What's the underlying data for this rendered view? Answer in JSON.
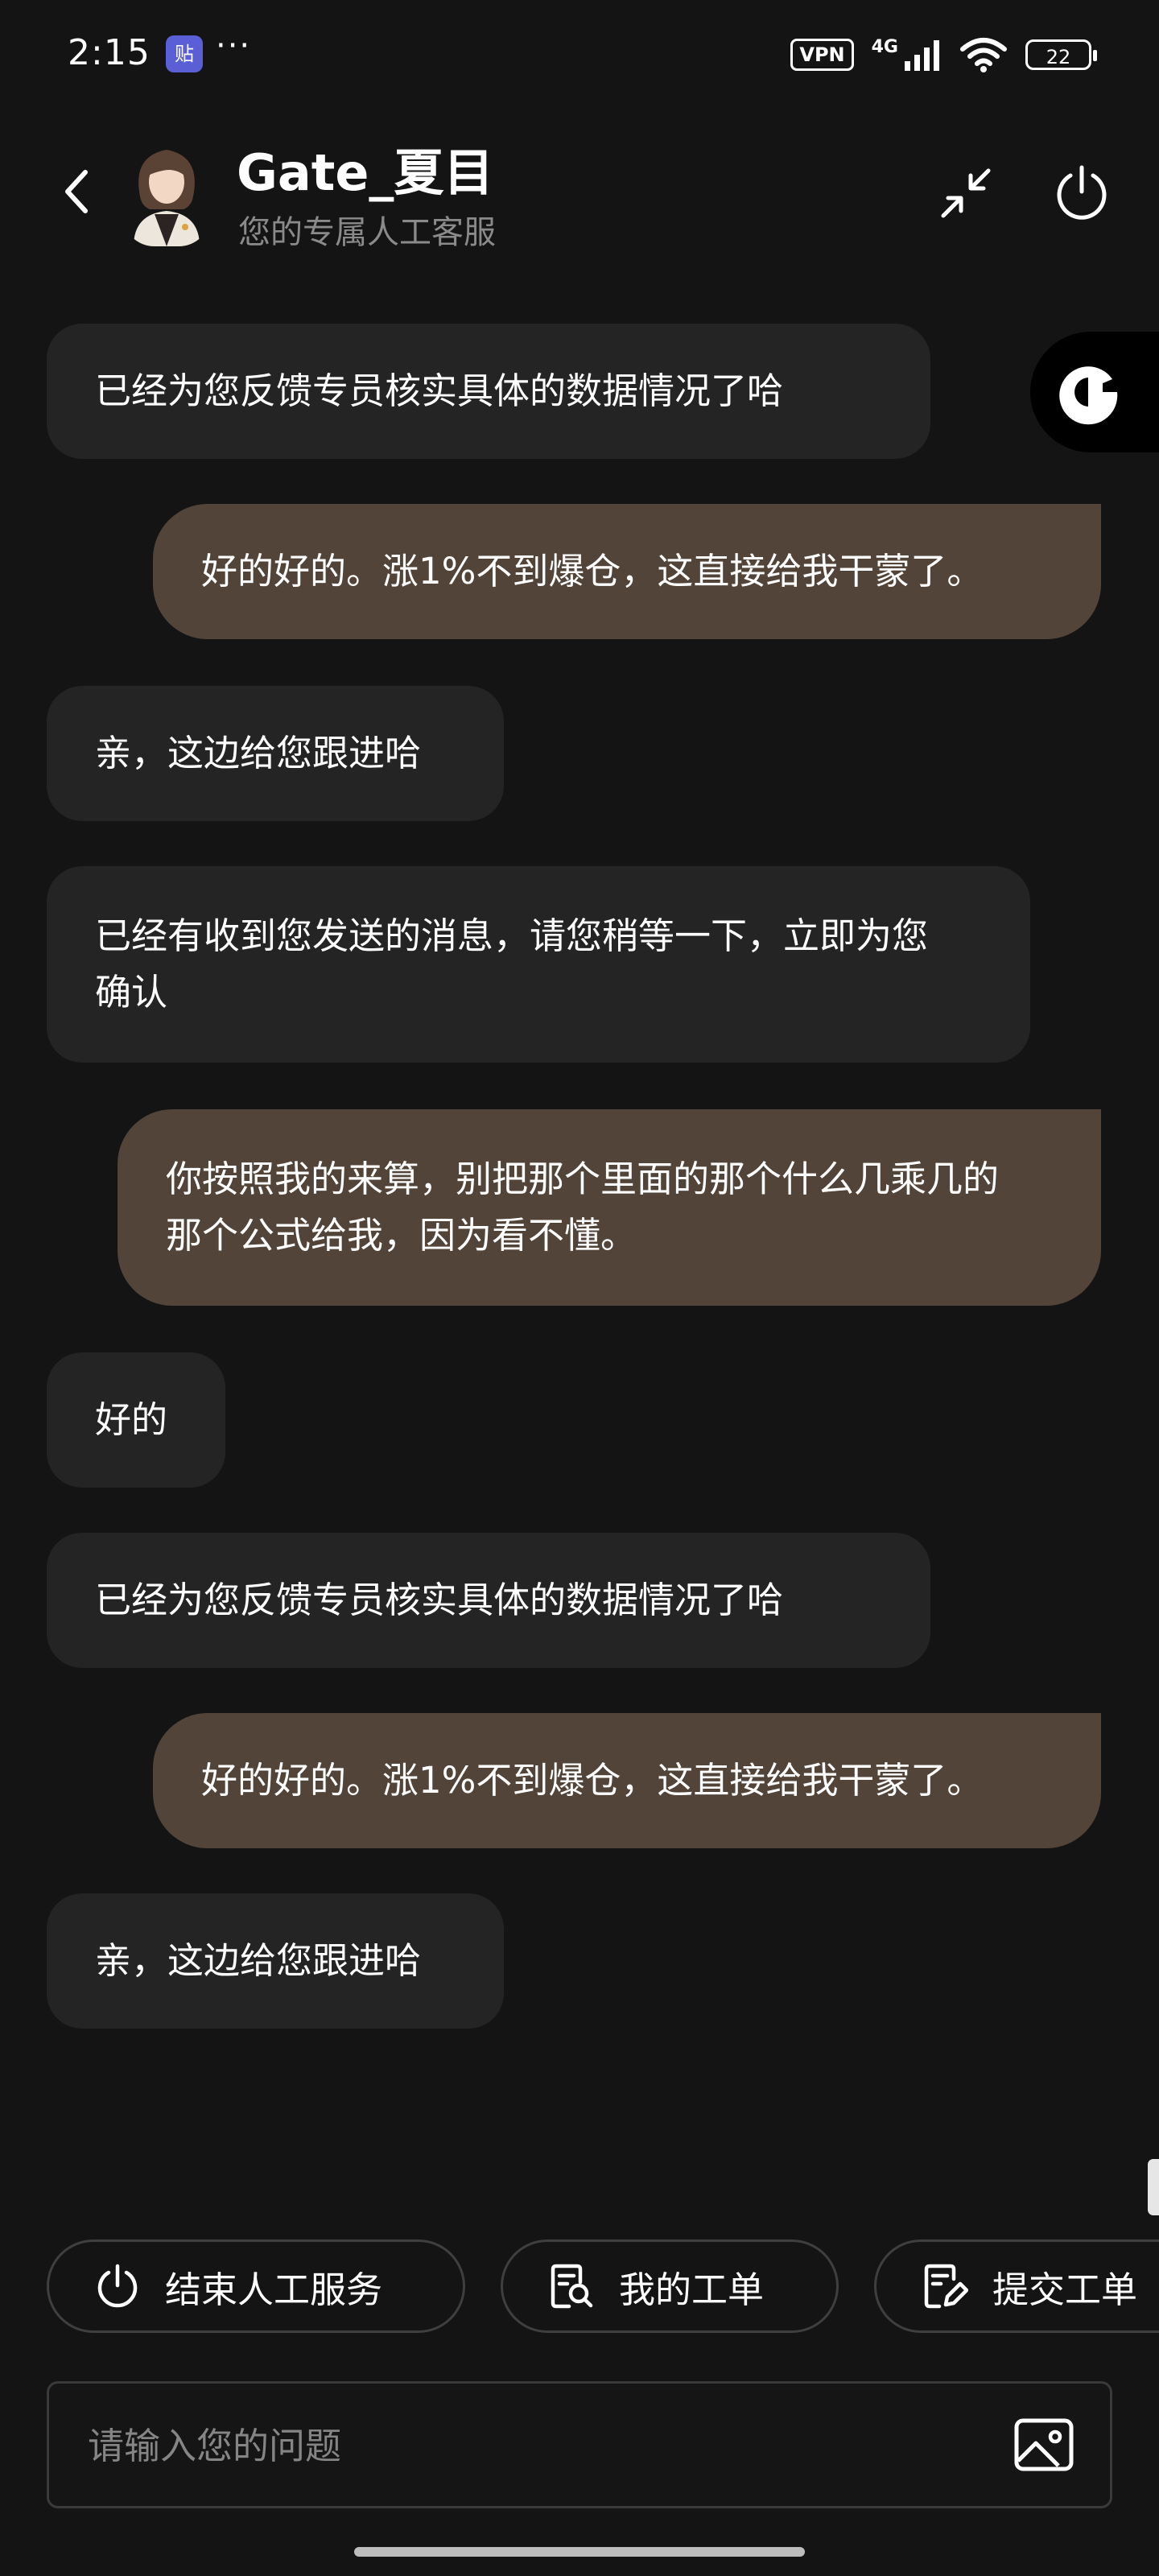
{
  "status_bar": {
    "time": "2:15",
    "app_icon_glyph": "贴",
    "more": "···",
    "vpn": "VPN",
    "network": "4G",
    "battery": "22"
  },
  "header": {
    "title": "Gate_夏目",
    "subtitle": "您的专属人工客服"
  },
  "messages": [
    {
      "sender": "agent",
      "text": "已经为您反馈专员核实具体的数据情况了哈"
    },
    {
      "sender": "user",
      "text": "好的好的。涨1%不到爆仓，这直接给我干蒙了。"
    },
    {
      "sender": "agent",
      "text": "亲，这边给您跟进哈"
    },
    {
      "sender": "agent",
      "text": "已经有收到您发送的消息，请您稍等一下，立即为您确认"
    },
    {
      "sender": "user",
      "text": "你按照我的来算，别把那个里面的那个什么几乘几的那个公式给我，因为看不懂。"
    },
    {
      "sender": "agent",
      "text": "好的"
    },
    {
      "sender": "agent",
      "text": "已经为您反馈专员核实具体的数据情况了哈"
    },
    {
      "sender": "user",
      "text": "好的好的。涨1%不到爆仓，这直接给我干蒙了。"
    },
    {
      "sender": "agent",
      "text": "亲，这边给您跟进哈"
    }
  ],
  "quick_actions": [
    {
      "label": "结束人工服务",
      "icon": "power-icon"
    },
    {
      "label": "我的工单",
      "icon": "ticket-search-icon"
    },
    {
      "label": "提交工单",
      "icon": "edit-ticket-icon"
    }
  ],
  "input": {
    "placeholder": "请输入您的问题"
  },
  "colors": {
    "background": "#141414",
    "agent_bubble": "#242424",
    "user_bubble": "#524438",
    "subtitle": "#8a8a8a"
  }
}
